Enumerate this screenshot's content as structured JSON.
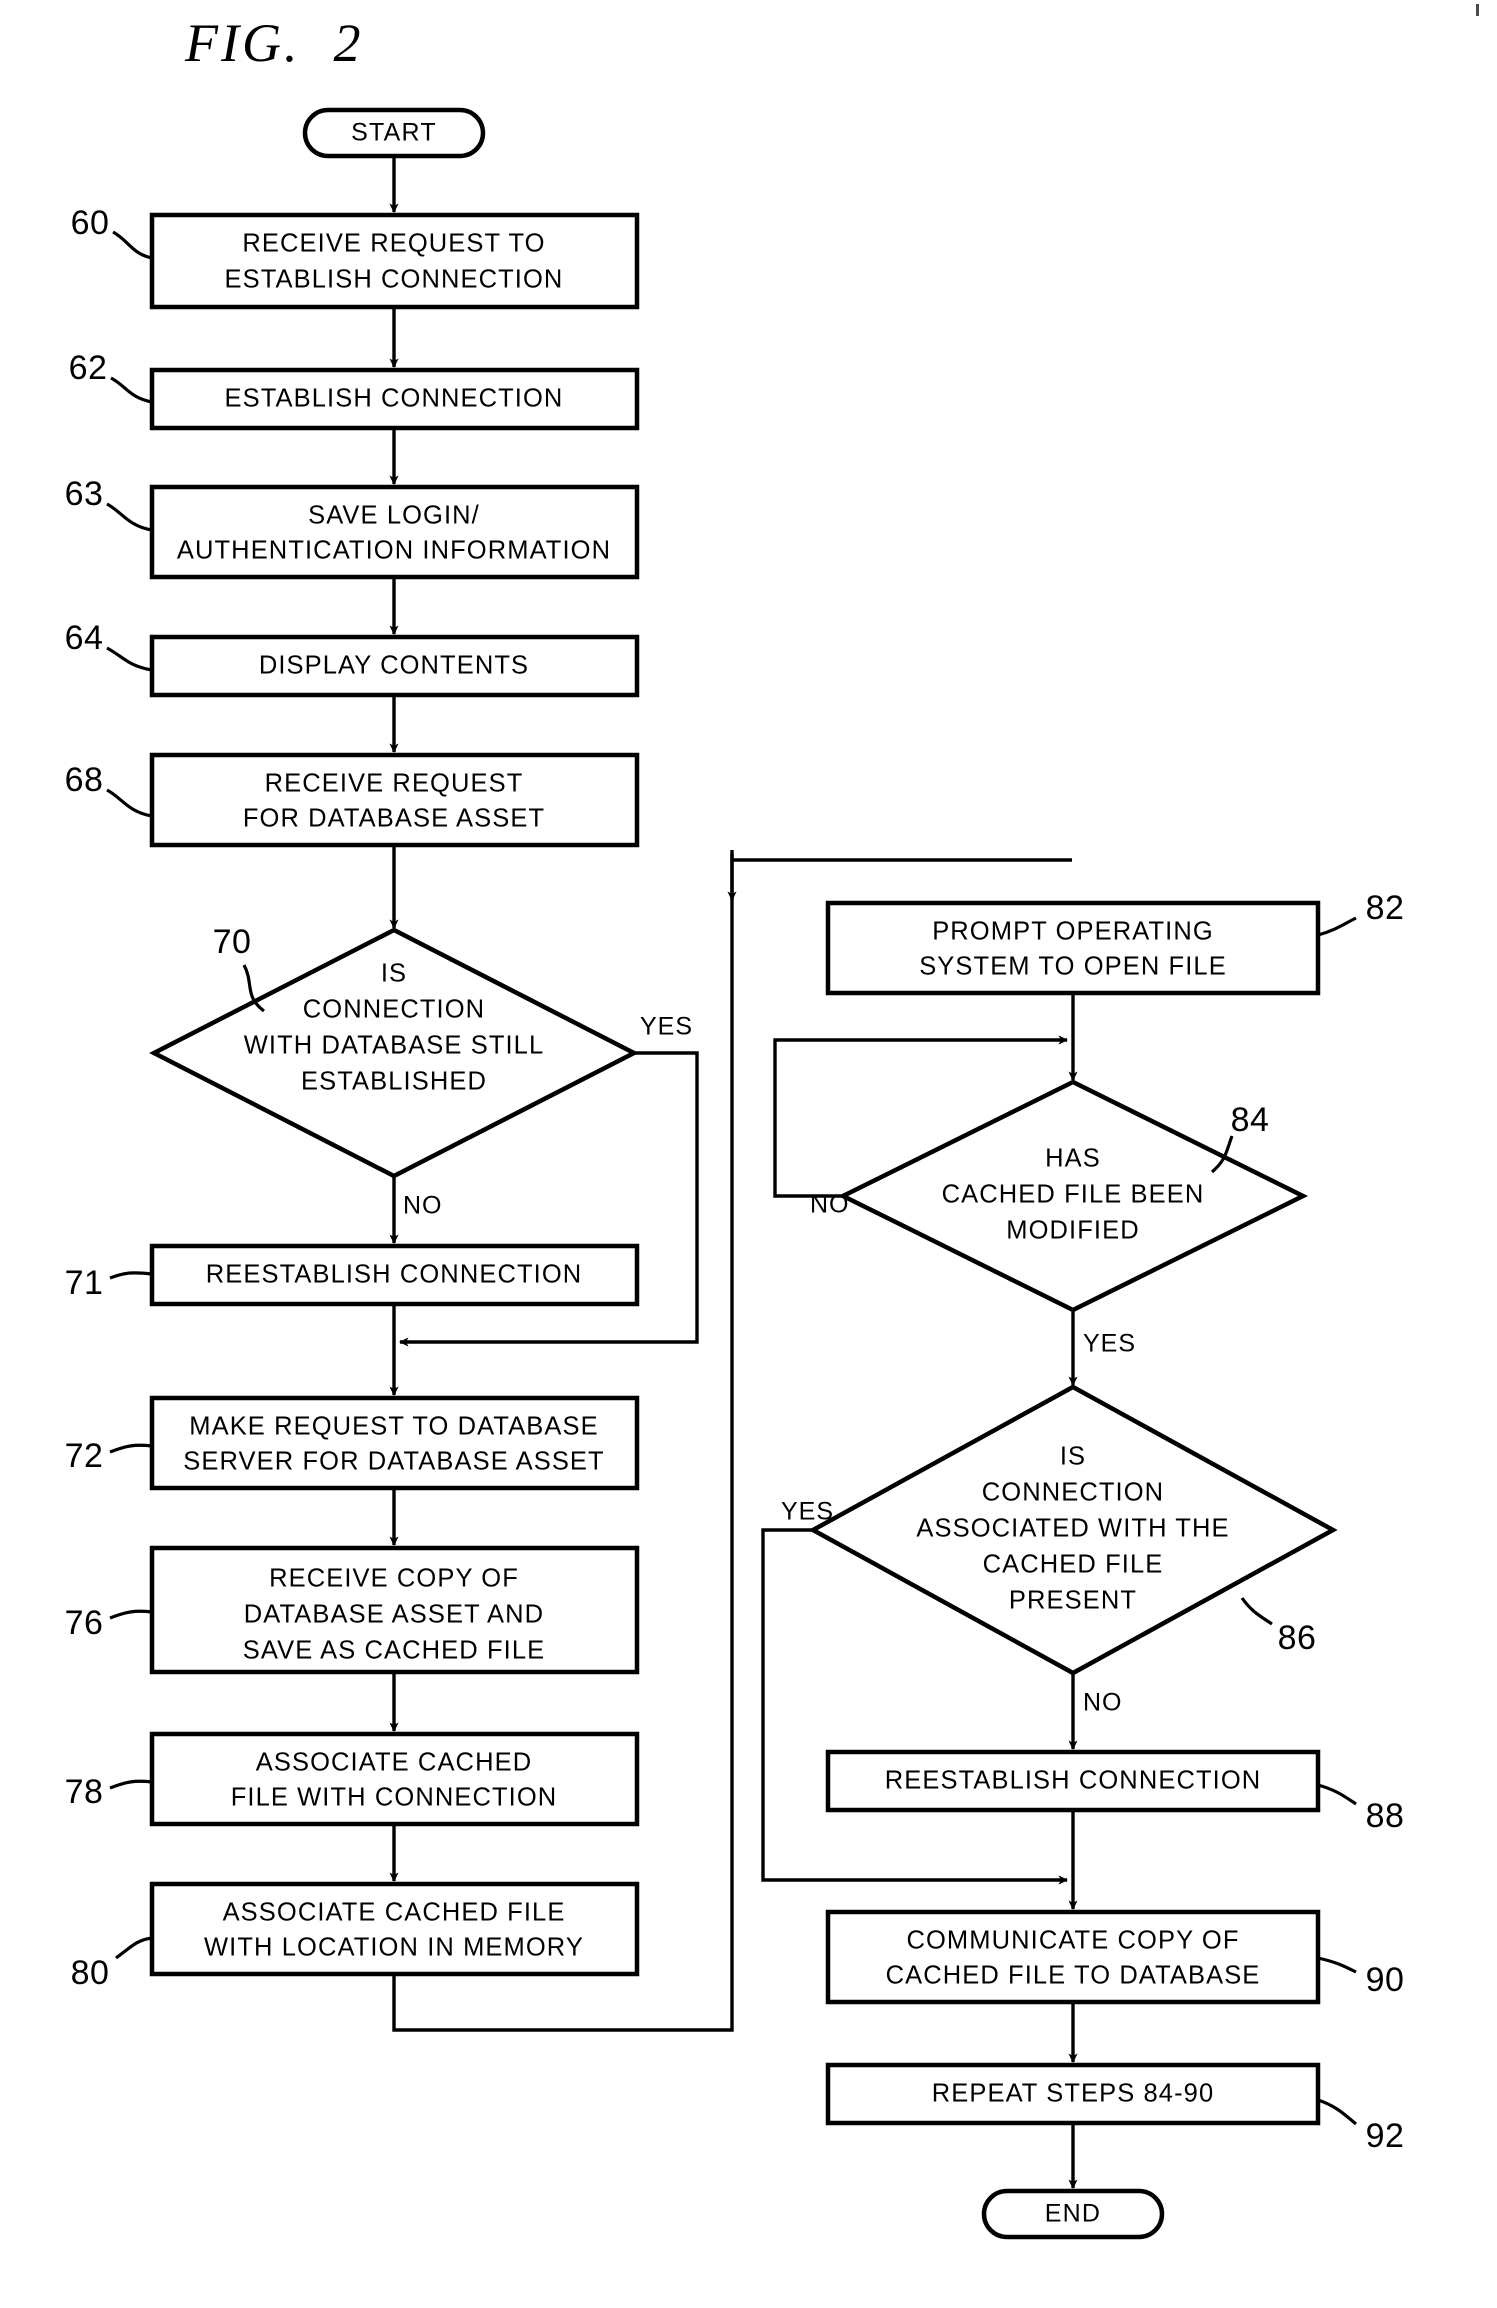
{
  "figure": {
    "title": "FIG.  2",
    "domain_label": "patent-flowchart"
  },
  "terminals": {
    "start": "START",
    "end": "END"
  },
  "edge_labels": {
    "yes": "YES",
    "no": "NO"
  },
  "left_column": {
    "nodes": [
      {
        "ref": "60",
        "type": "process",
        "lines": [
          "RECEIVE REQUEST TO",
          "ESTABLISH CONNECTION"
        ]
      },
      {
        "ref": "62",
        "type": "process",
        "lines": [
          "ESTABLISH  CONNECTION"
        ]
      },
      {
        "ref": "63",
        "type": "process",
        "lines": [
          "SAVE LOGIN/",
          "AUTHENTICATION  INFORMATION"
        ]
      },
      {
        "ref": "64",
        "type": "process",
        "lines": [
          "DISPLAY  CONTENTS"
        ]
      },
      {
        "ref": "68",
        "type": "process",
        "lines": [
          "RECEIVE REQUEST",
          "FOR DATABASE ASSET"
        ]
      },
      {
        "ref": "70",
        "type": "decision",
        "lines": [
          "IS",
          "CONNECTION",
          "WITH DATABASE STILL",
          "ESTABLISHED"
        ]
      },
      {
        "ref": "71",
        "type": "process",
        "lines": [
          "REESTABLISH  CONNECTION"
        ]
      },
      {
        "ref": "72",
        "type": "process",
        "lines": [
          "MAKE REQUEST TO DATABASE",
          "SERVER FOR DATABASE ASSET"
        ]
      },
      {
        "ref": "76",
        "type": "process",
        "lines": [
          "RECEIVE COPY OF",
          "DATABASE ASSET AND",
          "SAVE AS CACHED FILE"
        ]
      },
      {
        "ref": "78",
        "type": "process",
        "lines": [
          "ASSOCIATE CACHED",
          "FILE WITH CONNECTION"
        ]
      },
      {
        "ref": "80",
        "type": "process",
        "lines": [
          "ASSOCIATE CACHED FILE",
          "WITH LOCATION IN MEMORY"
        ]
      }
    ]
  },
  "right_column": {
    "nodes": [
      {
        "ref": "82",
        "type": "process",
        "lines": [
          "PROMPT OPERATING",
          "SYSTEM TO OPEN FILE"
        ]
      },
      {
        "ref": "84",
        "type": "decision",
        "lines": [
          "HAS",
          "CACHED FILE BEEN",
          "MODIFIED"
        ]
      },
      {
        "ref": "86",
        "type": "decision",
        "lines": [
          "IS",
          "CONNECTION",
          "ASSOCIATED WITH THE",
          "CACHED FILE",
          "PRESENT"
        ]
      },
      {
        "ref": "88",
        "type": "process",
        "lines": [
          "REESTABLISH  CONNECTION"
        ]
      },
      {
        "ref": "90",
        "type": "process",
        "lines": [
          "COMMUNICATE COPY OF",
          "CACHED FILE TO DATABASE"
        ]
      },
      {
        "ref": "92",
        "type": "process",
        "lines": [
          "REPEAT STEPS 84-90"
        ]
      }
    ]
  },
  "colors": {
    "ink": "#000000",
    "paper": "#ffffff"
  }
}
